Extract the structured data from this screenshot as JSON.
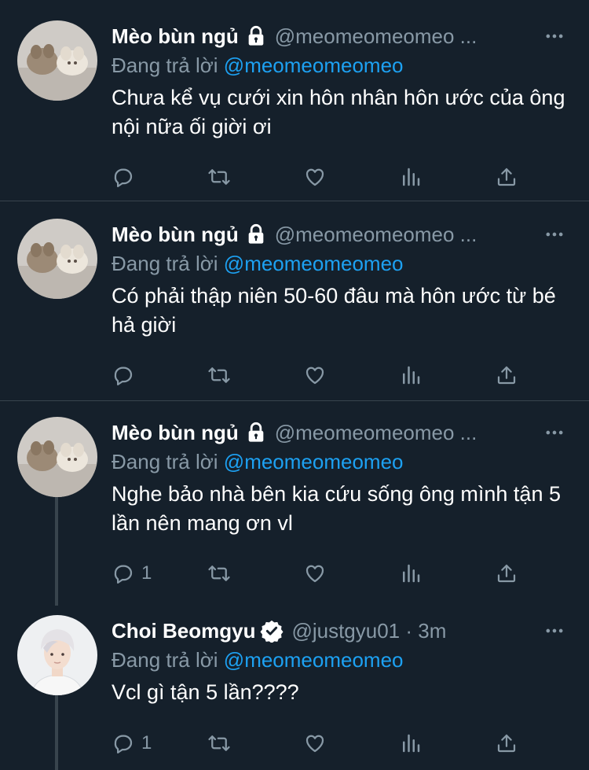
{
  "tweets": [
    {
      "name": "Mèo bùn ngủ",
      "handle": "@meomeomeomeo ...",
      "replying_prefix": "Đang trả lời",
      "replying_to": "@meomeomeomeo",
      "text": "Chưa kể vụ cưới xin hôn nhân hôn ước của ông nội nữa ối giời ơi",
      "reply_count": "",
      "locked": true,
      "verified": false
    },
    {
      "name": "Mèo bùn ngủ",
      "handle": "@meomeomeomeo ...",
      "replying_prefix": "Đang trả lời",
      "replying_to": "@meomeomeomeo",
      "text": "Có phải thập niên 50-60 đâu mà hôn ước từ bé hả giời",
      "reply_count": "",
      "locked": true,
      "verified": false
    },
    {
      "name": "Mèo bùn ngủ",
      "handle": "@meomeomeomeo ...",
      "replying_prefix": "Đang trả lời",
      "replying_to": "@meomeomeomeo",
      "text": "Nghe bảo nhà bên kia cứu sống ông mình tận 5 lần nên mang ơn vl",
      "reply_count": "1",
      "locked": true,
      "verified": false
    },
    {
      "name": "Choi Beomgyu",
      "handle": "@justgyu01 · 3m",
      "replying_prefix": "Đang trả lời",
      "replying_to": "@meomeomeomeo",
      "text": "Vcl gì tận 5 lần????",
      "reply_count": "1",
      "locked": false,
      "verified": true
    }
  ],
  "colors": {
    "background": "#15202b",
    "secondary_text": "#8899a6",
    "accent": "#1da1f2",
    "divider": "#38444d"
  },
  "icons": [
    "more-icon",
    "lock-icon",
    "verified-badge-icon",
    "reply-icon",
    "retweet-icon",
    "like-icon",
    "stats-icon",
    "share-icon"
  ]
}
